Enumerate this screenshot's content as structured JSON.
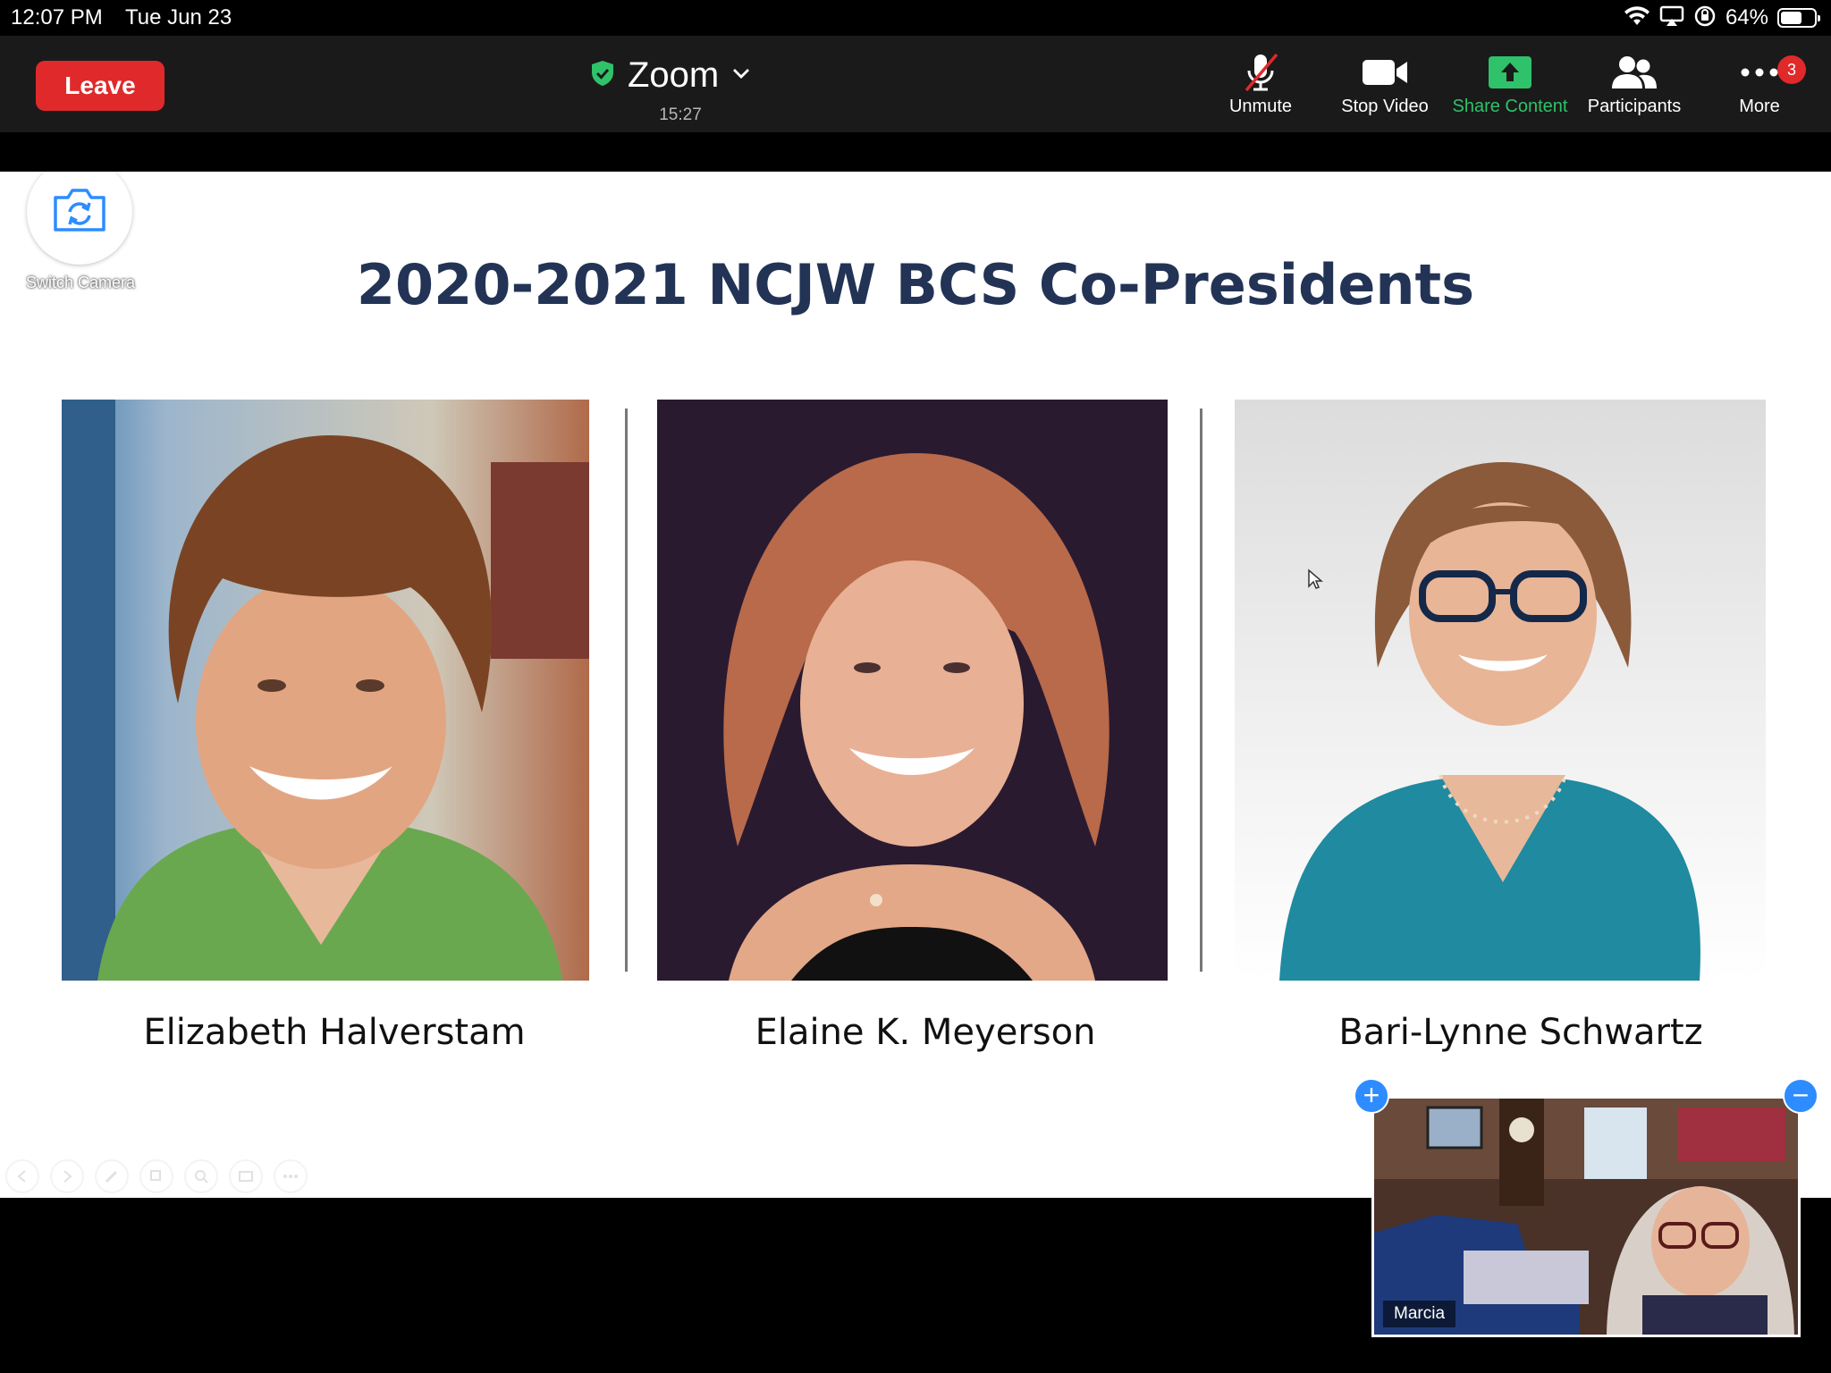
{
  "status_bar": {
    "time": "12:07 PM",
    "date": "Tue Jun 23",
    "battery_pct": "64%",
    "battery_level": 0.64,
    "icons": [
      "wifi-icon",
      "airplay-icon",
      "orientation-lock-icon",
      "battery-icon"
    ]
  },
  "toolbar": {
    "leave_label": "Leave",
    "meeting_name": "Zoom",
    "meeting_timer": "15:27",
    "unmute_label": "Unmute",
    "stop_video_label": "Stop Video",
    "share_label": "Share Content",
    "participants_label": "Participants",
    "more_label": "More",
    "more_badge": "3",
    "colors": {
      "leave": "#e0292b",
      "share": "#2fc26a",
      "shield": "#2fc26a",
      "badge": "#e0292b"
    }
  },
  "slide": {
    "title": "2020-2021 NCJW BCS Co-Presidents",
    "presidents": [
      {
        "name": "Elizabeth Halverstam"
      },
      {
        "name": "Elaine K. Meyerson"
      },
      {
        "name": "Bari-Lynne Schwartz"
      }
    ],
    "switch_camera_label": "Switch Camera"
  },
  "self_view": {
    "name": "Marcia"
  }
}
